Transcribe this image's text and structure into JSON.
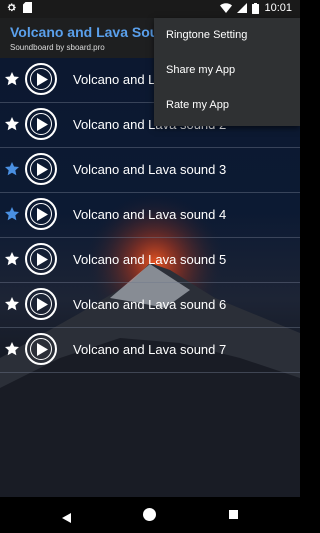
{
  "status_bar": {
    "time": "10:01"
  },
  "header": {
    "title": "Volcano and Lava Sounds",
    "subtitle": "Soundboard by sboard.pro"
  },
  "menu": {
    "items": [
      {
        "label": "Ringtone Setting"
      },
      {
        "label": "Share my App"
      },
      {
        "label": "Rate my App"
      }
    ]
  },
  "sounds": [
    {
      "title": "Volcano and Lava sound 1",
      "favorite": false
    },
    {
      "title": "Volcano and Lava sound 2",
      "favorite": false
    },
    {
      "title": "Volcano and Lava sound 3",
      "favorite": true
    },
    {
      "title": "Volcano and Lava sound 4",
      "favorite": true
    },
    {
      "title": "Volcano and Lava sound 5",
      "favorite": false
    },
    {
      "title": "Volcano and Lava sound 6",
      "favorite": false
    },
    {
      "title": "Volcano and Lava sound 7",
      "favorite": false
    }
  ],
  "colors": {
    "accent": "#5aa0ec",
    "star_on": "#4a90e2",
    "star_off": "#ffffff",
    "menu_bg": "#2f3133"
  },
  "icons": {
    "favorite": "star-icon",
    "play": "play-icon"
  }
}
